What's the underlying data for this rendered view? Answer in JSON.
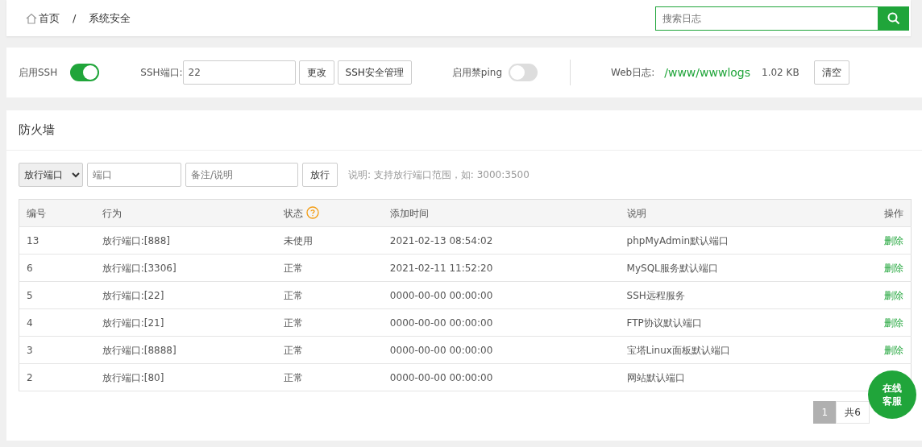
{
  "breadcrumb": {
    "home": "首页",
    "separator": "/",
    "current": "系统安全"
  },
  "search": {
    "placeholder": "搜索日志"
  },
  "settings": {
    "ssh_label": "启用SSH",
    "ssh_on": true,
    "port_label": "SSH端口:",
    "port_value": "22",
    "change_button": "更改",
    "ssh_manage_button": "SSH安全管理",
    "ping_label": "启用禁ping",
    "ping_on": false,
    "log_label": "Web日志:",
    "log_path": "/www/wwwlogs",
    "log_size": "1.02 KB",
    "clear_button": "清空"
  },
  "firewall": {
    "title": "防火墙",
    "action_select": "放行端口",
    "port_placeholder": "端口",
    "note_placeholder": "备注/说明",
    "submit_button": "放行",
    "hint": "说明: 支持放行端口范围，如: 3000:3500",
    "columns": [
      "编号",
      "行为",
      "状态",
      "添加时间",
      "说明",
      "操作"
    ],
    "rows": [
      {
        "id": "13",
        "action": "放行端口:[888]",
        "status": "未使用",
        "time": "2021-02-13 08:54:02",
        "note": "phpMyAdmin默认端口",
        "op": "删除"
      },
      {
        "id": "6",
        "action": "放行端口:[3306]",
        "status": "正常",
        "time": "2021-02-11 11:52:20",
        "note": "MySQL服务默认端口",
        "op": "删除"
      },
      {
        "id": "5",
        "action": "放行端口:[22]",
        "status": "正常",
        "time": "0000-00-00 00:00:00",
        "note": "SSH远程服务",
        "op": "删除"
      },
      {
        "id": "4",
        "action": "放行端口:[21]",
        "status": "正常",
        "time": "0000-00-00 00:00:00",
        "note": "FTP协议默认端口",
        "op": "删除"
      },
      {
        "id": "3",
        "action": "放行端口:[8888]",
        "status": "正常",
        "time": "0000-00-00 00:00:00",
        "note": "宝塔Linux面板默认端口",
        "op": "删除"
      },
      {
        "id": "2",
        "action": "放行端口:[80]",
        "status": "正常",
        "time": "0000-00-00 00:00:00",
        "note": "网站默认端口"
      }
    ],
    "pagination": {
      "pages": [
        {
          "label": "1",
          "selected": true
        }
      ],
      "total": "共6"
    }
  },
  "chat_button": {
    "line1": "在线",
    "line2": "客服"
  }
}
